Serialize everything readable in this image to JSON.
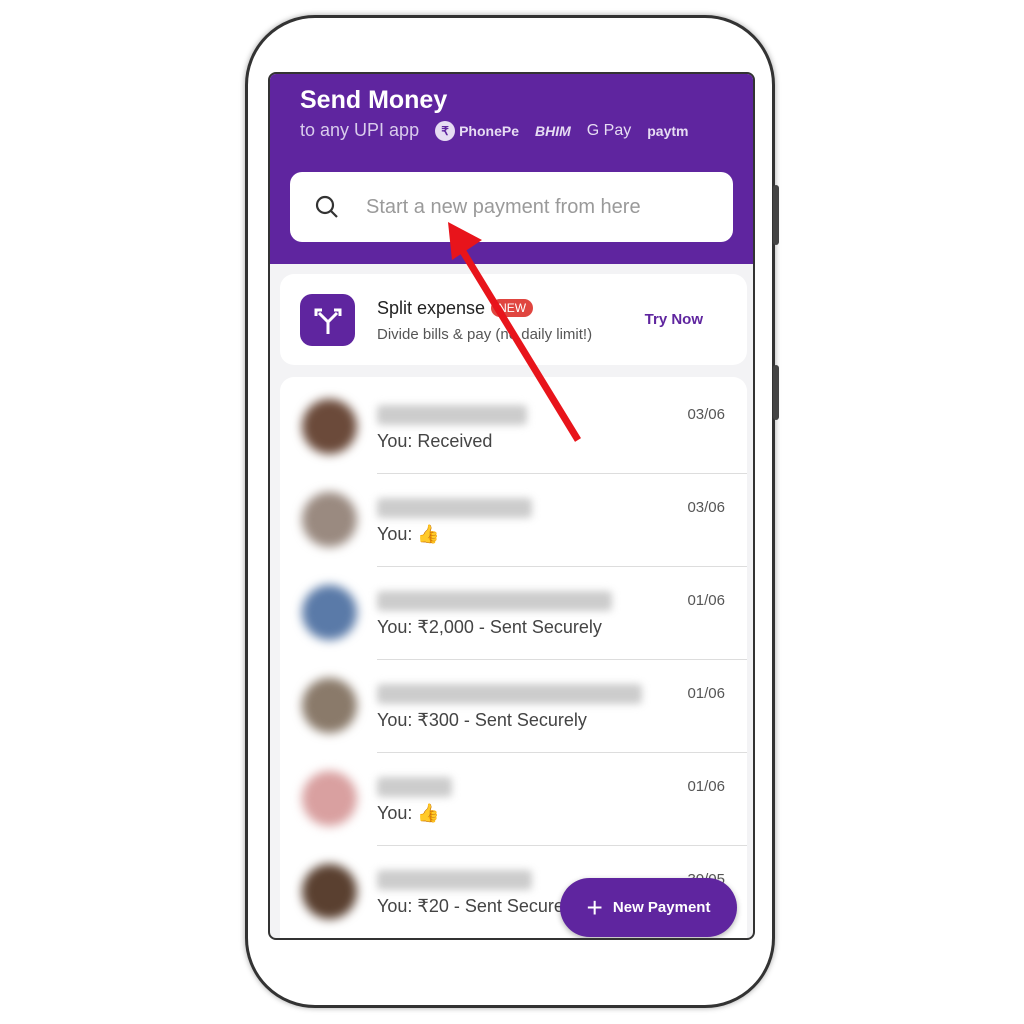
{
  "header": {
    "title": "Send Money",
    "subtitle": "to any UPI app",
    "upi_apps": [
      "PhonePe",
      "BHIM",
      "G Pay",
      "paytm"
    ]
  },
  "search": {
    "placeholder": "Start a new payment from here"
  },
  "promo": {
    "title": "Split expense",
    "badge": "NEW",
    "subtitle": "Divide bills & pay (no daily limit!)",
    "action": "Try Now"
  },
  "chats": [
    {
      "message": "You: Received",
      "date": "03/06",
      "avatar_color": "#6b4a3a"
    },
    {
      "message": "You: 👍",
      "date": "03/06",
      "avatar_color": "#9a8a80"
    },
    {
      "message": "You: ₹2,000 - Sent Securely",
      "date": "01/06",
      "avatar_color": "#5a7aa8"
    },
    {
      "message": "You: ₹300 - Sent Securely",
      "date": "01/06",
      "avatar_color": "#8a7a6a"
    },
    {
      "message": "You: 👍",
      "date": "01/06",
      "avatar_color": "#d9a0a0"
    },
    {
      "message": "You: ₹20 - Sent Securely",
      "date": "30/05",
      "avatar_color": "#5a4030"
    }
  ],
  "fab": {
    "label": "New Payment"
  },
  "colors": {
    "brand": "#5f259f",
    "badge": "#e0453f",
    "annotation_arrow": "#e8141b"
  }
}
